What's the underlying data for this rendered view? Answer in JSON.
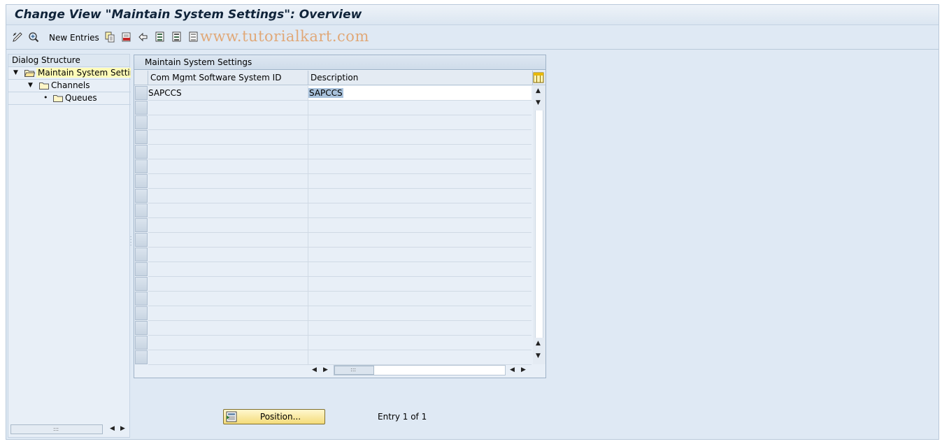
{
  "window": {
    "title": "Change View \"Maintain System Settings\": Overview"
  },
  "toolbar": {
    "new_entries_label": "New Entries",
    "watermark": "www.tutorialkart.com",
    "icons": [
      "change-display-icon",
      "details-icon",
      "copy-as-icon",
      "delete-icon",
      "undo-change-icon",
      "select-all-icon",
      "select-block-icon",
      "deselect-all-icon"
    ]
  },
  "dialog_structure": {
    "header": "Dialog Structure",
    "items": [
      {
        "label": "Maintain System Setting",
        "level": 0,
        "expanded": true,
        "selected": true
      },
      {
        "label": "Channels",
        "level": 1,
        "expanded": true,
        "selected": false
      },
      {
        "label": "Queues",
        "level": 2,
        "expanded": false,
        "selected": false
      }
    ]
  },
  "table": {
    "title": "Maintain System Settings",
    "columns": [
      "Com Mgmt Software System ID",
      "Description"
    ],
    "rows": [
      {
        "system_id": "SAPCCS",
        "description": "SAPCCS"
      }
    ],
    "empty_rows": 18
  },
  "footer": {
    "position_button_label": "Position...",
    "entry_info": "Entry 1 of 1"
  },
  "colors": {
    "background": "#dfe9f4",
    "selected_tree_item": "#fffbb7",
    "button": "#f4dc7a",
    "highlight": "#aac3dd"
  }
}
